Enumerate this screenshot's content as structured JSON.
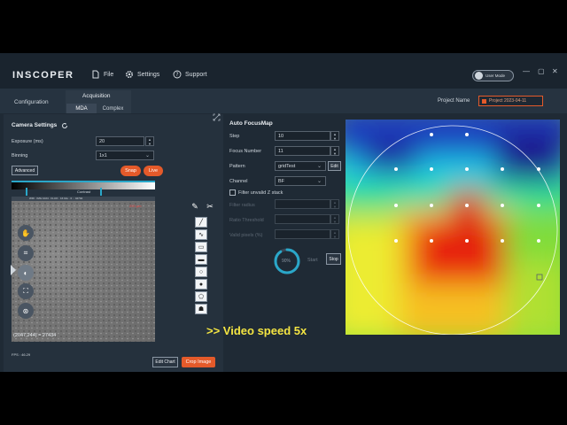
{
  "header": {
    "logo": "INSCOPER",
    "menu": {
      "file": "File",
      "settings": "Settings",
      "support": "Support"
    },
    "user_mode": "User Mode",
    "window_buttons": {
      "minimize": "—",
      "maximize": "▢",
      "close": "✕"
    }
  },
  "tabs": {
    "configuration": "Configuration",
    "acquisition": "Acquisition",
    "mda": "MDA",
    "complex": "Complex",
    "project_label": "Project Name",
    "project_value": "Project 2023-04-11"
  },
  "camera": {
    "title": "Camera Settings",
    "exposure_label": "Exposure (ms)",
    "exposure_value": "20",
    "binning_label": "Binning",
    "binning_value": "1x1",
    "advanced": "Advanced",
    "snap": "Snap",
    "live": "Live",
    "contrast": "Contrast",
    "image_caption": "WID · IMG 1024 · FLUO · 16 bits  ·  0 ·· 42794",
    "scale_note": "200 µm",
    "coord": "(2047,244) = 27434",
    "fps": "FPS : 46.29",
    "edit_chart": "Edit Chart",
    "crop_image": "Crop Image",
    "histo_range": {
      "low": 0.1,
      "high": 0.62
    }
  },
  "overlay": {
    "speed_text": ">> Video speed 5x"
  },
  "focus": {
    "title": "Auto FocusMap",
    "step_label": "Step",
    "step_value": "10",
    "focus_number_label": "Focus Number",
    "focus_number_value": "11",
    "pattern_label": "Pattern",
    "pattern_value": "gridTest",
    "pattern_edit": "Edit",
    "channel_label": "Channel",
    "channel_value": "BF",
    "filter_check": "Filter unvalid Z stack",
    "filter_radius_label": "Filter radius",
    "ratio_label": "Ratio Threshold",
    "valid_label": "Valid pixels (%)",
    "progress_text": "90%",
    "progress": 0.9,
    "start": "Start",
    "stop": "Stop"
  },
  "colors": {
    "accent_orange": "#e45a2a",
    "accent_cyan": "#2aa7c9",
    "speed_yellow": "#f4e542"
  }
}
